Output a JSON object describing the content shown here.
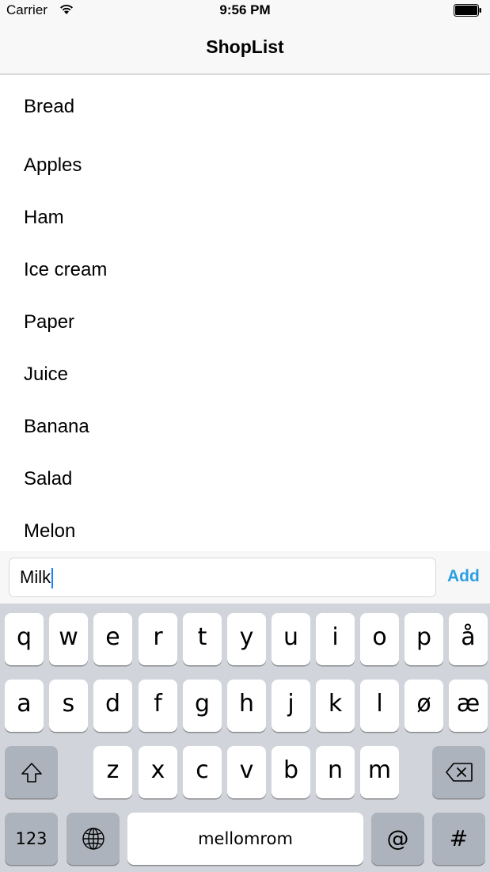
{
  "status_bar": {
    "carrier": "Carrier",
    "time": "9:56 PM"
  },
  "nav": {
    "title": "ShopList"
  },
  "list": {
    "items": [
      "Bread",
      "Apples",
      "Ham",
      "Ice cream",
      "Paper",
      "Juice",
      "Banana",
      "Salad",
      "Melon"
    ]
  },
  "input": {
    "value": "Milk",
    "add_label": "Add"
  },
  "keyboard": {
    "row1": [
      "q",
      "w",
      "e",
      "r",
      "t",
      "y",
      "u",
      "i",
      "o",
      "p",
      "å"
    ],
    "row2": [
      "a",
      "s",
      "d",
      "f",
      "g",
      "h",
      "j",
      "k",
      "l",
      "ø",
      "æ"
    ],
    "row3": [
      "z",
      "x",
      "c",
      "v",
      "b",
      "n",
      "m"
    ],
    "numbers_label": "123",
    "space_label": "mellomrom",
    "at_label": "@",
    "hash_label": "#",
    "icons": {
      "shift": "shift-icon",
      "backspace": "backspace-icon",
      "globe": "globe-icon"
    }
  },
  "colors": {
    "accent": "#2b9ee3",
    "keyboard_bg": "#d1d5db",
    "special_key": "#adb3bc"
  }
}
